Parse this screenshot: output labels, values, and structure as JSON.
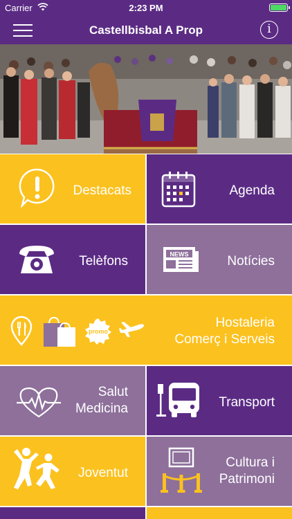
{
  "status": {
    "carrier": "Carrier",
    "time": "2:23 PM"
  },
  "nav": {
    "title": "Castellbisbal A Prop",
    "info_glyph": "i"
  },
  "tiles": {
    "destacats": "Destacats",
    "agenda": "Agenda",
    "telefons": "Telèfons",
    "noticies": "Notícies",
    "hostaleria": "Hostaleria\nComerç i Serveis",
    "salut": "Salut\nMedicina",
    "transport": "Transport",
    "joventut": "Joventut",
    "cultura": "Cultura i\nPatrimoni"
  },
  "icons": {
    "news_badge": "NEWS",
    "promo_badge": "promo"
  },
  "colors": {
    "purple": "#5b2b84",
    "yellow": "#fbc11e",
    "mauve": "#8e709b"
  }
}
